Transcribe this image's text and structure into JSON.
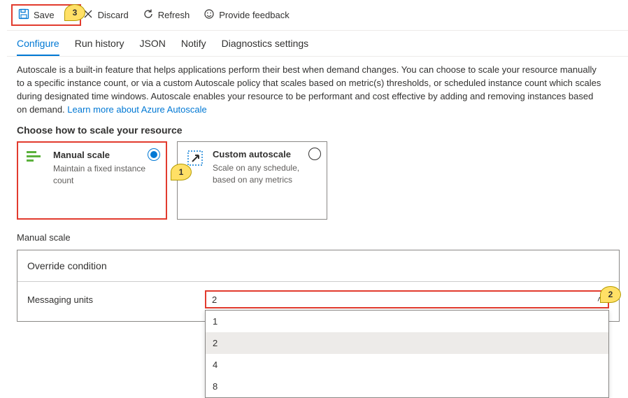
{
  "toolbar": {
    "save": "Save",
    "discard": "Discard",
    "refresh": "Refresh",
    "feedback": "Provide feedback"
  },
  "tabs": {
    "configure": "Configure",
    "run_history": "Run history",
    "json": "JSON",
    "notify": "Notify",
    "diagnostics": "Diagnostics settings"
  },
  "description": {
    "text": "Autoscale is a built-in feature that helps applications perform their best when demand changes. You can choose to scale your resource manually to a specific instance count, or via a custom Autoscale policy that scales based on metric(s) thresholds, or scheduled instance count which scales during designated time windows. Autoscale enables your resource to be performant and cost effective by adding and removing instances based on demand. ",
    "link": "Learn more about Azure Autoscale"
  },
  "section_title": "Choose how to scale your resource",
  "cards": {
    "manual": {
      "title": "Manual scale",
      "sub": "Maintain a fixed instance count"
    },
    "custom": {
      "title": "Custom autoscale",
      "sub": "Scale on any schedule, based on any metrics"
    }
  },
  "manual_section": {
    "heading": "Manual scale",
    "override": "Override condition",
    "units_label": "Messaging units",
    "units_value": "2",
    "options": [
      "1",
      "2",
      "4",
      "8"
    ]
  },
  "callouts": {
    "c1": "1",
    "c2": "2",
    "c3": "3"
  }
}
